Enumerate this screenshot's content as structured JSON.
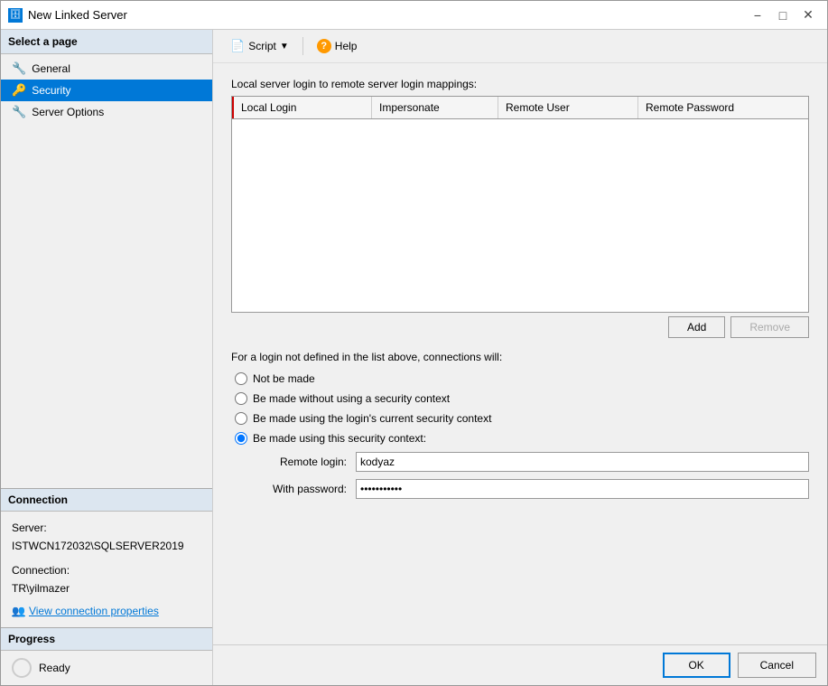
{
  "window": {
    "title": "New Linked Server",
    "icon": "🗄"
  },
  "titlebar": {
    "minimize": "−",
    "maximize": "□",
    "close": "✕"
  },
  "sidebar": {
    "select_page_label": "Select a page",
    "items": [
      {
        "id": "general",
        "label": "General",
        "active": false
      },
      {
        "id": "security",
        "label": "Security",
        "active": true
      },
      {
        "id": "server-options",
        "label": "Server Options",
        "active": false
      }
    ]
  },
  "connection_section": {
    "header": "Connection",
    "server_label": "Server:",
    "server_value": "ISTWCN172032\\SQLSERVER2019",
    "connection_label": "Connection:",
    "connection_value": "TR\\yilmazer",
    "link_label": "View connection properties"
  },
  "progress_section": {
    "header": "Progress",
    "status": "Ready"
  },
  "toolbar": {
    "script_label": "Script",
    "help_label": "Help"
  },
  "main": {
    "login_mapping_label": "Local server login to remote server login mappings:",
    "table": {
      "columns": [
        "Local Login",
        "Impersonate",
        "Remote User",
        "Remote Password"
      ],
      "rows": []
    },
    "add_button": "Add",
    "remove_button": "Remove",
    "connections_label": "For a login not defined in the list above, connections will:",
    "radio_options": [
      {
        "id": "not-be-made",
        "label": "Not be made",
        "checked": false
      },
      {
        "id": "without-security",
        "label": "Be made without using a security context",
        "checked": false
      },
      {
        "id": "current-context",
        "label": "Be made using the login's current security context",
        "checked": false
      },
      {
        "id": "this-context",
        "label": "Be made using this security context:",
        "checked": true
      }
    ],
    "remote_login_label": "Remote login:",
    "remote_login_value": "kodyaz",
    "password_label": "With password:",
    "password_value": "***********"
  },
  "footer": {
    "ok_label": "OK",
    "cancel_label": "Cancel"
  }
}
